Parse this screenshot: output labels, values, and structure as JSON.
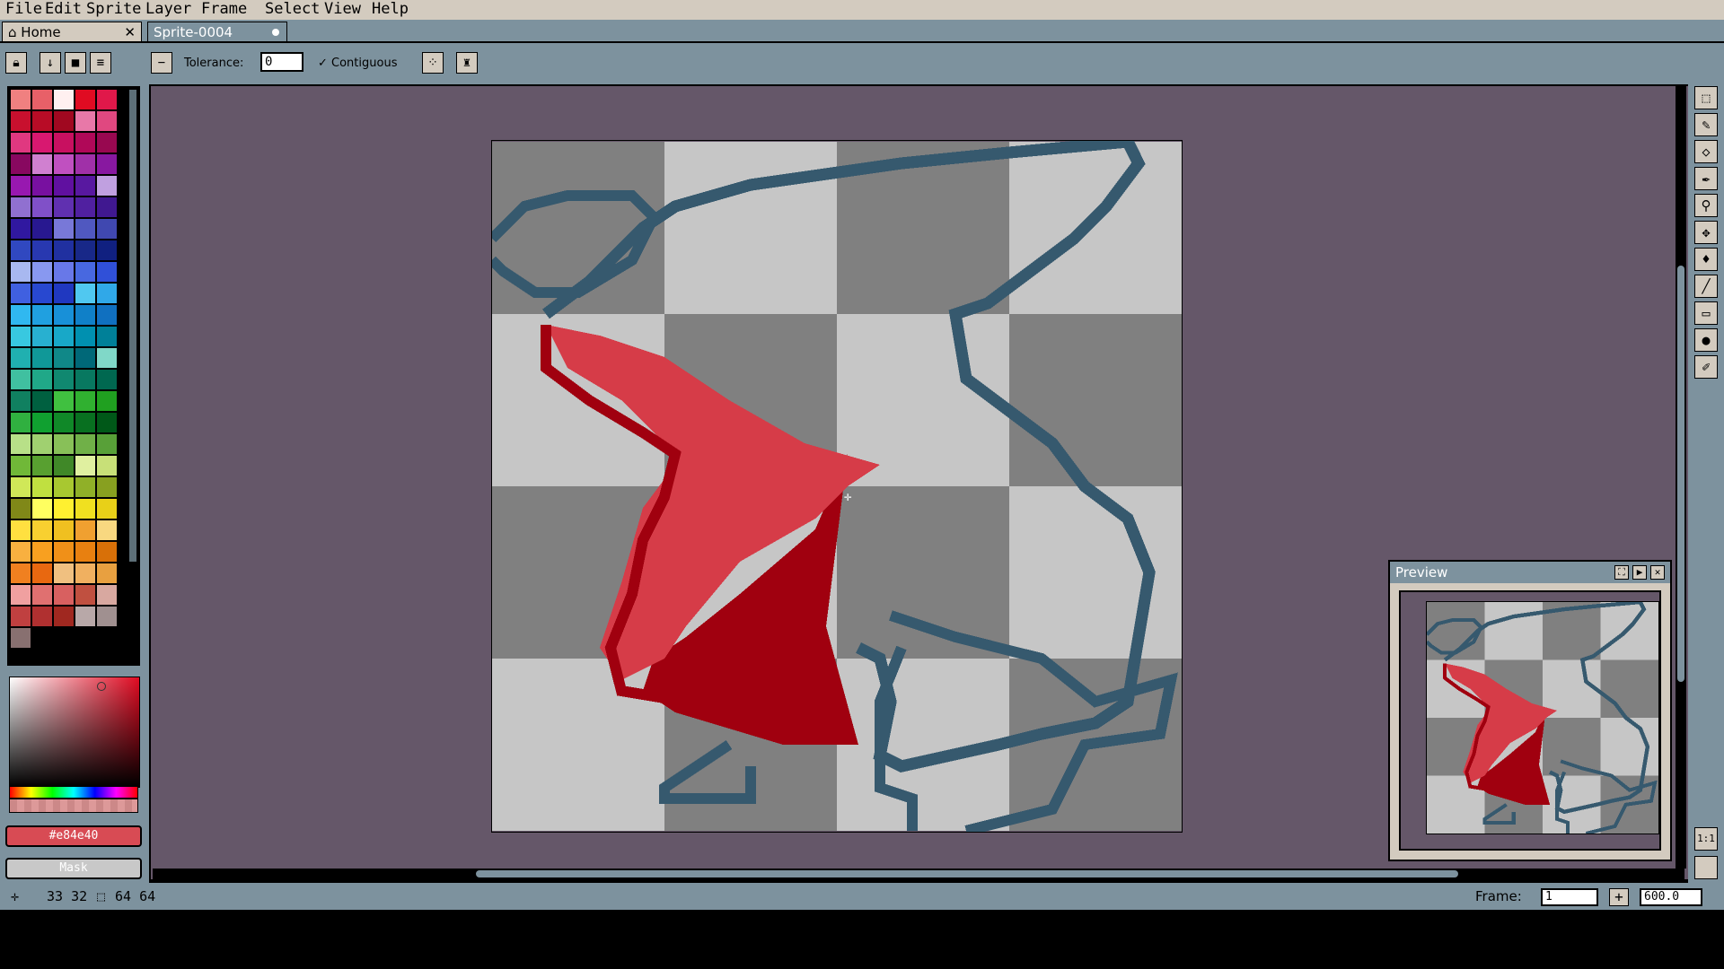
{
  "menubar": {
    "items": [
      "File",
      "Edit",
      "Sprite",
      "Layer",
      "Frame",
      "Select",
      "View",
      "Help"
    ]
  },
  "tabs": [
    {
      "label": "Home",
      "icon": "home-icon",
      "close": "✕"
    },
    {
      "label": "Sprite-0004",
      "icon": "modified-dot"
    }
  ],
  "toolbar": {
    "tolerance_label": "Tolerance:",
    "tolerance_value": "0",
    "contiguous_label": "Contiguous",
    "contiguous_checked": true
  },
  "palette": {
    "colors": [
      "#f08080",
      "#e86068",
      "#fff0f0",
      "#e00b22",
      "#e0184a",
      "#c8102e",
      "#b80c26",
      "#a00820",
      "#e878a8",
      "#e04880",
      "#e03880",
      "#d81870",
      "#c81060",
      "#b00858",
      "#980850",
      "#880860",
      "#d080d0",
      "#c050c0",
      "#a030a8",
      "#8818a0",
      "#9818b0",
      "#7810a0",
      "#6010a0",
      "#5818a0",
      "#c0a0e0",
      "#9070d0",
      "#8050c8",
      "#6030b0",
      "#5020a0",
      "#401890",
      "#3018a0",
      "#281890",
      "#7878d8",
      "#5058c0",
      "#4048b0",
      "#3048c0",
      "#2838b0",
      "#2030a0",
      "#182888",
      "#102080",
      "#a8b8f0",
      "#8898f0",
      "#6878e8",
      "#4868e0",
      "#3050d8",
      "#4060e0",
      "#2848d0",
      "#2038c0",
      "#50c8f0",
      "#30a8e8",
      "#30b8f0",
      "#20a0e0",
      "#1890d8",
      "#1080c8",
      "#1070c0",
      "#38c8e0",
      "#28b0d0",
      "#18a8c8",
      "#0090b0",
      "#008098",
      "#20b0b0",
      "#109898",
      "#108888",
      "#006878",
      "#80d8c8",
      "#40c0a0",
      "#20a888",
      "#108870",
      "#087860",
      "#006850",
      "#108060",
      "#006040",
      "#40c040",
      "#30b030",
      "#20a020",
      "#30b040",
      "#10a030",
      "#108828",
      "#087020",
      "#005818",
      "#b8e088",
      "#a0d070",
      "#88c058",
      "#70b048",
      "#58a038",
      "#70b838",
      "#58a030",
      "#408828",
      "#e0f0a0",
      "#c8e078",
      "#d0e858",
      "#c0e040",
      "#a8c830",
      "#90b028",
      "#88a020",
      "#808818",
      "#ffff60",
      "#fff030",
      "#f0e020",
      "#e8d018",
      "#ffe040",
      "#f8d030",
      "#f0c020",
      "#f0a030",
      "#f8d880",
      "#f8b040",
      "#f8a020",
      "#f09018",
      "#e88010",
      "#d87008",
      "#f08020",
      "#e86810",
      "#f0c080",
      "#f0b060",
      "#e8a040",
      "#f0a0a0",
      "#e07070",
      "#d86060",
      "#c05040",
      "#d8a8a0",
      "#c04040",
      "#b03030",
      "#a02820",
      "#b8a8a8",
      "#a09090",
      "#887070"
    ]
  },
  "foreground_color": "#d84b54",
  "foreground_hex_label": "#e84e40",
  "mask_label": "Mask",
  "preview": {
    "title": "Preview"
  },
  "statusbar": {
    "cursor_pos": "33 32",
    "sprite_size": "64 64",
    "frame_label": "Frame:",
    "frame_value": "1",
    "zoom_value": "600.0"
  },
  "tools": [
    "rectangular-marquee",
    "pencil",
    "eraser",
    "eyedropper",
    "zoom",
    "move",
    "paint-bucket",
    "line",
    "rectangle",
    "blur",
    "spray"
  ],
  "colors": {
    "ui_bg": "#7d929e",
    "ui_light": "#d3cbbf",
    "editor_bg": "#655769",
    "checker_light": "#c6c6c6",
    "checker_dark": "#808080",
    "outline": "#36596e",
    "fill_light": "#d63c48",
    "fill_dark": "#a0000f"
  }
}
